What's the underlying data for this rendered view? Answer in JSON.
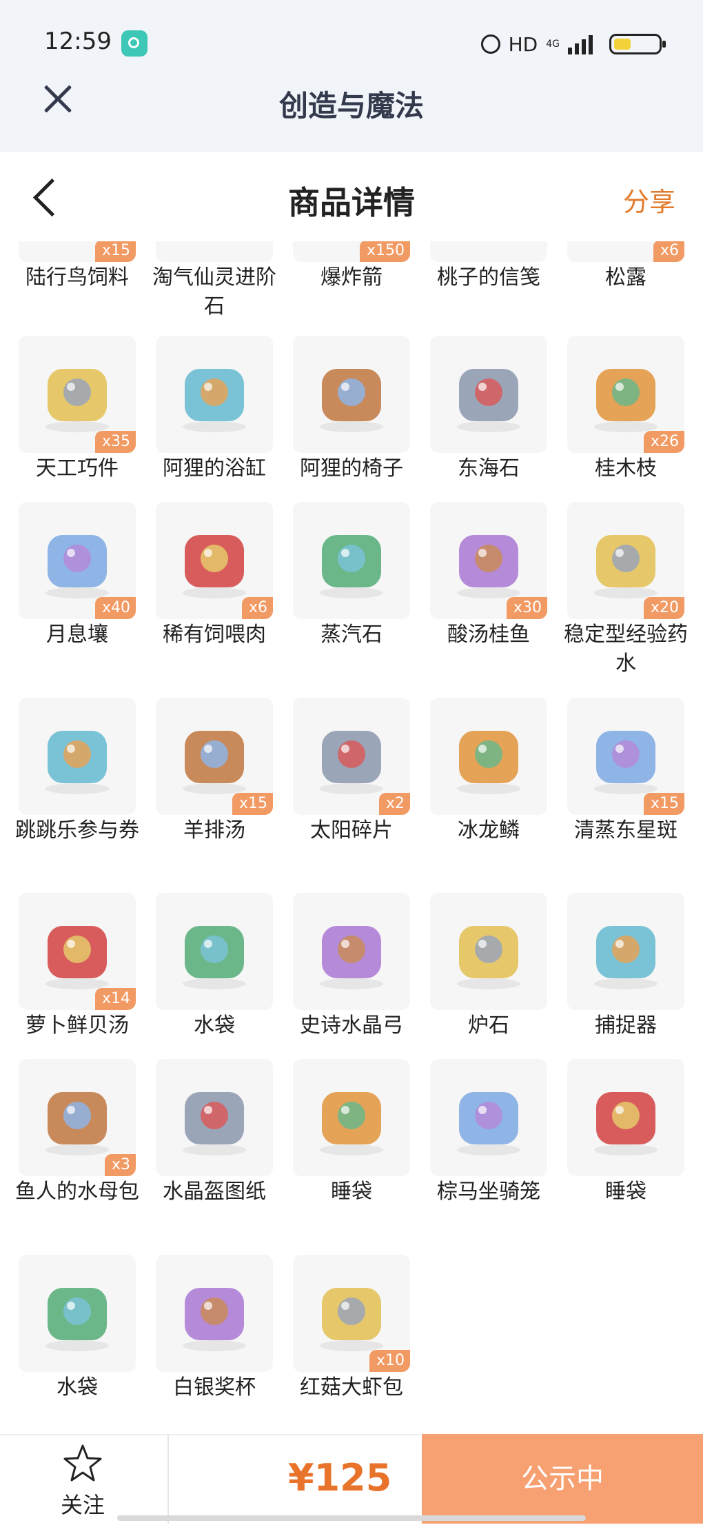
{
  "status_bar": {
    "time": "12:59",
    "network": "HD",
    "network_sub": "4G"
  },
  "miniapp": {
    "title": "创造与魔法"
  },
  "header": {
    "title": "商品详情",
    "share": "分享"
  },
  "colors": {
    "accent": "#e37b2b",
    "badge": "#f29a63",
    "status_button": "#f7a071",
    "price": "#e8732b"
  },
  "items": [
    {
      "name": "陆行鸟饲料",
      "qty": "x15",
      "icon": "feed-icon"
    },
    {
      "name": "淘气仙灵进阶石",
      "qty": "",
      "icon": "stone-icon"
    },
    {
      "name": "爆炸箭",
      "qty": "x150",
      "icon": "arrow-icon"
    },
    {
      "name": "桃子的信笺",
      "qty": "",
      "icon": "letter-icon"
    },
    {
      "name": "松露",
      "qty": "x6",
      "icon": "truffle-icon"
    },
    {
      "name": "天工巧件",
      "qty": "x35",
      "icon": "gear-part-icon"
    },
    {
      "name": "阿狸的浴缸",
      "qty": "",
      "icon": "bathtub-icon"
    },
    {
      "name": "阿狸的椅子",
      "qty": "",
      "icon": "chair-icon"
    },
    {
      "name": "东海石",
      "qty": "",
      "icon": "rock-icon"
    },
    {
      "name": "桂木枝",
      "qty": "x26",
      "icon": "branch-icon"
    },
    {
      "name": "月息壤",
      "qty": "x40",
      "icon": "crystal-soil-icon"
    },
    {
      "name": "稀有饲喂肉",
      "qty": "x6",
      "icon": "meat-icon"
    },
    {
      "name": "蒸汽石",
      "qty": "",
      "icon": "steam-stone-icon"
    },
    {
      "name": "酸汤桂鱼",
      "qty": "x30",
      "icon": "fish-dish-icon"
    },
    {
      "name": "稳定型经验药水",
      "qty": "x20",
      "icon": "potion-icon"
    },
    {
      "name": "跳跳乐参与券",
      "qty": "",
      "icon": "ticket-icon"
    },
    {
      "name": "羊排汤",
      "qty": "x15",
      "icon": "soup-icon"
    },
    {
      "name": "太阳碎片",
      "qty": "x2",
      "icon": "sun-shard-icon"
    },
    {
      "name": "冰龙鳞",
      "qty": "",
      "icon": "ice-scale-icon"
    },
    {
      "name": "清蒸东星斑",
      "qty": "x15",
      "icon": "steamed-fish-icon"
    },
    {
      "name": "萝卜鲜贝汤",
      "qty": "x14",
      "icon": "bowl-soup-icon"
    },
    {
      "name": "水袋",
      "qty": "",
      "icon": "water-bag-icon"
    },
    {
      "name": "史诗水晶弓",
      "qty": "",
      "icon": "bow-icon"
    },
    {
      "name": "炉石",
      "qty": "",
      "icon": "hearthstone-icon"
    },
    {
      "name": "捕捉器",
      "qty": "",
      "icon": "trap-icon"
    },
    {
      "name": "鱼人的水母包",
      "qty": "x3",
      "icon": "pouch-icon"
    },
    {
      "name": "水晶盔图纸",
      "qty": "",
      "icon": "scroll-icon"
    },
    {
      "name": "睡袋",
      "qty": "",
      "icon": "sleeping-bag-icon"
    },
    {
      "name": "棕马坐骑笼",
      "qty": "",
      "icon": "mount-cage-icon"
    },
    {
      "name": "睡袋",
      "qty": "",
      "icon": "sleeping-bag-icon"
    },
    {
      "name": "水袋",
      "qty": "",
      "icon": "water-bag-icon"
    },
    {
      "name": "白银奖杯",
      "qty": "",
      "icon": "trophy-icon"
    },
    {
      "name": "红菇大虾包",
      "qty": "x10",
      "icon": "dumpling-icon"
    }
  ],
  "bottom": {
    "follow": "关注",
    "price": "¥125",
    "status_button": "公示中"
  }
}
